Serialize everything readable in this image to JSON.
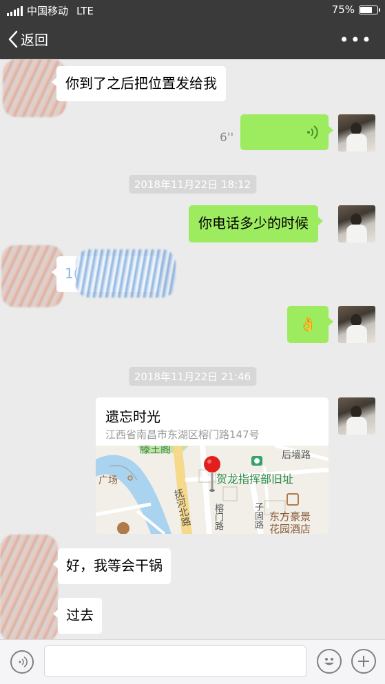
{
  "status_bar": {
    "carrier": "中国移动",
    "network": "LTE",
    "battery_percent": "75%",
    "battery_level": 0.75
  },
  "nav": {
    "back_label": "返回",
    "more_label": "•••"
  },
  "messages": [
    {
      "type": "text",
      "direction": "incoming",
      "text": "你到了之后把位置发给我"
    },
    {
      "type": "voice",
      "direction": "outgoing",
      "duration": "6''"
    },
    {
      "type": "timestamp",
      "text": "2018年11月22日 18:12"
    },
    {
      "type": "text",
      "direction": "outgoing",
      "text": "你电话多少的时候"
    },
    {
      "type": "text",
      "direction": "incoming",
      "text": "1(",
      "redacted": true
    },
    {
      "type": "emoji",
      "direction": "outgoing",
      "text": "👌"
    },
    {
      "type": "timestamp",
      "text": "2018年11月22日 21:46"
    },
    {
      "type": "location",
      "direction": "outgoing",
      "title": "遗忘时光",
      "address": "江西省南昌市东湖区榕门路147号",
      "map_labels": [
        "滕王阁",
        "后墙路",
        "广场",
        "贺龙指挥部旧址",
        "抚河北路",
        "榕门路",
        "子固路",
        "东方豪景",
        "花园酒店"
      ]
    },
    {
      "type": "text",
      "direction": "incoming",
      "text": "好，我等会干锅"
    },
    {
      "type": "text",
      "direction": "incoming",
      "text": "过去"
    }
  ],
  "input_bar": {
    "voice_icon": "voice-wave-icon",
    "emoji_icon": "smiley-icon",
    "plus_icon": "plus-icon",
    "input_value": ""
  },
  "colors": {
    "bar_bg": "#3a3a3a",
    "chat_bg": "#ebebeb",
    "outgoing_bubble": "#9deb5e",
    "incoming_bubble": "#ffffff"
  }
}
